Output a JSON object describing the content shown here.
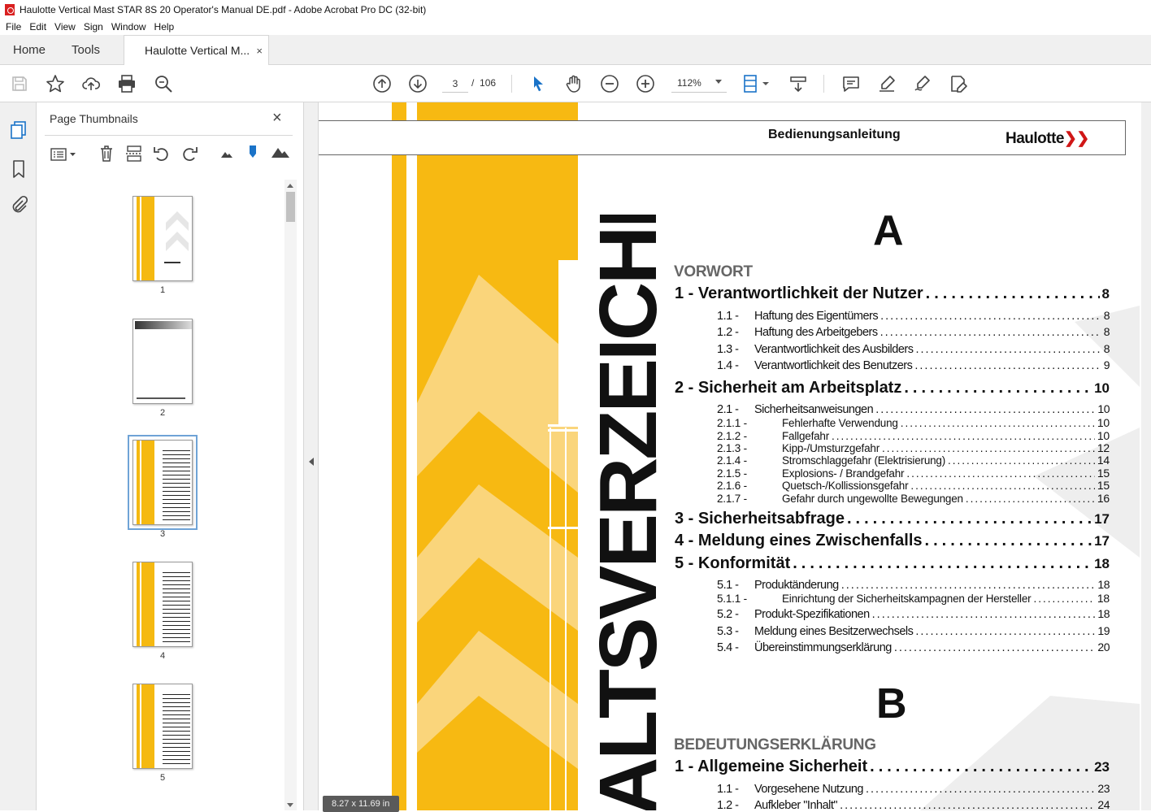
{
  "window": {
    "title": "Haulotte Vertical Mast STAR 8S 20 Operator's Manual DE.pdf - Adobe Acrobat Pro DC (32-bit)"
  },
  "menu": [
    "File",
    "Edit",
    "View",
    "Sign",
    "Window",
    "Help"
  ],
  "tabs": {
    "home": "Home",
    "tools": "Tools",
    "doc": "Haulotte Vertical M...",
    "doc_close": "×"
  },
  "toolbar": {
    "page_current": "3",
    "page_sep": "/",
    "page_total": "106",
    "zoom": "112%"
  },
  "panel": {
    "title": "Page Thumbnails",
    "close": "×",
    "thumbnails": [
      {
        "label": "1",
        "selected": false
      },
      {
        "label": "2",
        "selected": false
      },
      {
        "label": "3",
        "selected": true
      },
      {
        "label": "4",
        "selected": false
      },
      {
        "label": "5",
        "selected": false
      }
    ]
  },
  "page_size": "8.27 x 11.69 in",
  "document": {
    "header_title": "Bedienungsanleitung",
    "logo": "Haulotte",
    "logo_chevrons": "❯❯",
    "vertical_title": "ALTSVERZEICHNIS",
    "letter_a": "A",
    "letter_b": "B",
    "section_a": "VORWORT",
    "section_b": "BEDEUTUNGSERKLÄRUNG",
    "toc": [
      {
        "level": 1,
        "num": "1 -",
        "text": "Verantwortlichkeit der Nutzer",
        "page": "8"
      },
      {
        "level": 2,
        "num": "1.1 -",
        "text": "Haftung des Eigentümers",
        "page": "8"
      },
      {
        "level": 2,
        "num": "1.2 -",
        "text": "Haftung des Arbeitgebers",
        "page": "8"
      },
      {
        "level": 2,
        "num": "1.3 -",
        "text": "Verantwortlichkeit des Ausbilders",
        "page": "8"
      },
      {
        "level": 2,
        "num": "1.4 -",
        "text": "Verantwortlichkeit des Benutzers",
        "page": "9"
      },
      {
        "level": 1,
        "num": "2 -",
        "text": "Sicherheit am Arbeitsplatz",
        "page": "10"
      },
      {
        "level": 2,
        "num": "2.1 -",
        "text": "Sicherheitsanweisungen",
        "page": "10"
      },
      {
        "level": 3,
        "num": "2.1.1 -",
        "text": "Fehlerhafte Verwendung",
        "page": "10"
      },
      {
        "level": 3,
        "num": "2.1.2 -",
        "text": "Fallgefahr",
        "page": "10"
      },
      {
        "level": 3,
        "num": "2.1.3 -",
        "text": "Kipp-/Umsturzgefahr",
        "page": "12"
      },
      {
        "level": 3,
        "num": "2.1.4 -",
        "text": "Stromschlaggefahr (Elektrisierung)",
        "page": "14"
      },
      {
        "level": 3,
        "num": "2.1.5 -",
        "text": "Explosions- / Brandgefahr",
        "page": "15"
      },
      {
        "level": 3,
        "num": "2.1.6 -",
        "text": "Quetsch-/Kollissionsgefahr",
        "page": "15"
      },
      {
        "level": 3,
        "num": "2.1.7 -",
        "text": "Gefahr durch ungewollte Bewegungen",
        "page": "16"
      },
      {
        "level": 1,
        "num": "3 -",
        "text": "Sicherheitsabfrage",
        "page": "17"
      },
      {
        "level": 1,
        "num": "4 -",
        "text": "Meldung eines Zwischenfalls",
        "page": "17"
      },
      {
        "level": 1,
        "num": "5 -",
        "text": "Konformität",
        "page": "18"
      },
      {
        "level": 2,
        "num": "5.1 -",
        "text": "Produktänderung",
        "page": "18"
      },
      {
        "level": 3,
        "num": "5.1.1 -",
        "text": "Einrichtung der Sicherheitskampagnen der Hersteller",
        "page": "18"
      },
      {
        "level": 2,
        "num": "5.2 -",
        "text": "Produkt-Spezifikationen",
        "page": "18"
      },
      {
        "level": 2,
        "num": "5.3 -",
        "text": "Meldung eines Besitzerwechsels",
        "page": "19"
      },
      {
        "level": 2,
        "num": "5.4 -",
        "text": "Übereinstimmungserklärung",
        "page": "20"
      }
    ],
    "toc_b": [
      {
        "level": 1,
        "num": "1 -",
        "text": "Allgemeine Sicherheit",
        "page": "23"
      },
      {
        "level": 2,
        "num": "1.1 -",
        "text": "Vorgesehene Nutzung",
        "page": "23"
      },
      {
        "level": 2,
        "num": "1.2 -",
        "text": "Aufkleber \"Inhalt\"",
        "page": "24"
      }
    ]
  }
}
